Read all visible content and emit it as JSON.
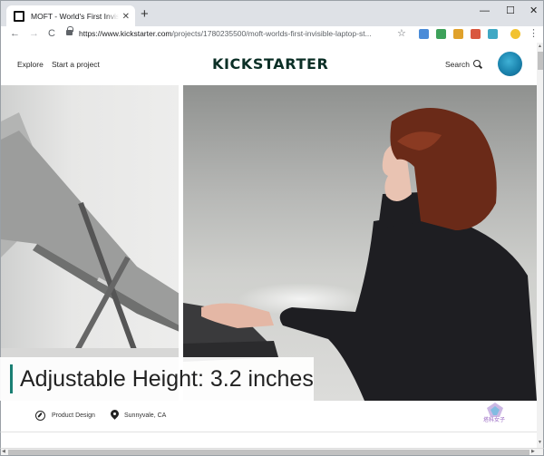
{
  "browser": {
    "tab_title": "MOFT - World's First Invisible Laptop Stand",
    "tab_close": "✕",
    "new_tab": "+",
    "window_minimize": "—",
    "window_maximize": "☐",
    "window_close": "✕",
    "back": "←",
    "forward": "→",
    "reload": "C",
    "url_host": "https://www.kickstarter.com",
    "url_path": "/projects/1780235500/moft-worlds-first-invisible-laptop-st...",
    "bookmark": "☆"
  },
  "site": {
    "explore": "Explore",
    "start_project": "Start a project",
    "logo": "KICKSTARTER",
    "search": "Search"
  },
  "hero": {
    "caption": "Adjustable Height: 3.2 inches"
  },
  "meta": {
    "category": "Product Design",
    "location": "Sunnyvale, CA",
    "watermark": "塔科女子"
  },
  "colors": {
    "logo": "#0b2f26",
    "caption_bar": "#1a7f73",
    "avatar": "#1b84ae"
  }
}
